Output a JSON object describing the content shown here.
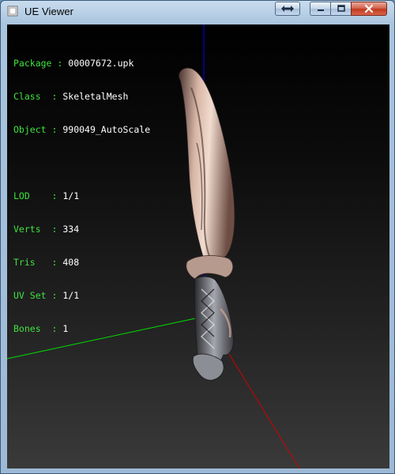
{
  "window": {
    "title": "UE Viewer",
    "icons": {
      "app": "app-icon",
      "resize": "double-arrow-icon",
      "minimize": "minimize-icon",
      "maximize": "maximize-icon",
      "close": "close-icon"
    }
  },
  "info": {
    "package": {
      "label": "Package",
      "sep": ":",
      "value": "00007672.upk"
    },
    "class": {
      "label": "Class  ",
      "sep": ":",
      "value": "SkeletalMesh"
    },
    "object": {
      "label": "Object ",
      "sep": ":",
      "value": "990049_AutoScale"
    },
    "lod": {
      "label": "LOD    ",
      "sep": ":",
      "value": "1/1"
    },
    "verts": {
      "label": "Verts  ",
      "sep": ":",
      "value": "334"
    },
    "tris": {
      "label": "Tris   ",
      "sep": ":",
      "value": "408"
    },
    "uvset": {
      "label": "UV Set ",
      "sep": ":",
      "value": "1/1"
    },
    "bones": {
      "label": "Bones  ",
      "sep": ":",
      "value": "1"
    }
  },
  "colors": {
    "label_green": "#3fe23f",
    "axis_x": "#e00000",
    "axis_y": "#00e000",
    "axis_z": "#0000ff"
  }
}
